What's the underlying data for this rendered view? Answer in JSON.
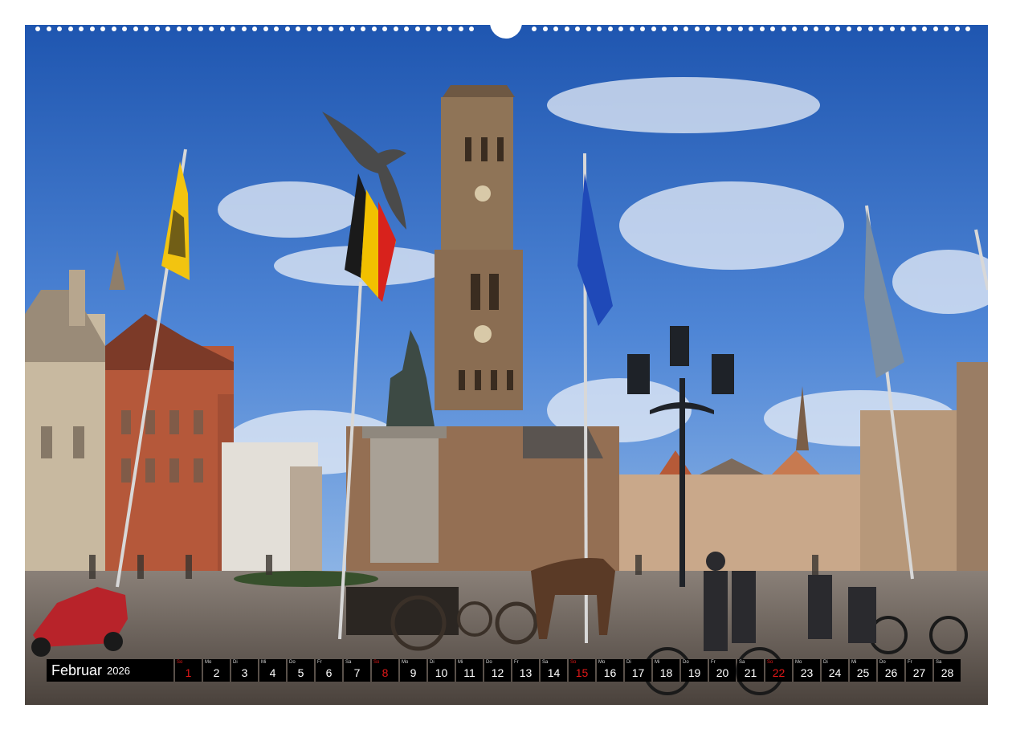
{
  "calendar": {
    "month": "Februar",
    "year": "2026",
    "days": [
      {
        "wd": "So",
        "num": "1",
        "sunday": true
      },
      {
        "wd": "Mo",
        "num": "2",
        "sunday": false
      },
      {
        "wd": "Di",
        "num": "3",
        "sunday": false
      },
      {
        "wd": "Mi",
        "num": "4",
        "sunday": false
      },
      {
        "wd": "Do",
        "num": "5",
        "sunday": false
      },
      {
        "wd": "Fr",
        "num": "6",
        "sunday": false
      },
      {
        "wd": "Sa",
        "num": "7",
        "sunday": false
      },
      {
        "wd": "So",
        "num": "8",
        "sunday": true
      },
      {
        "wd": "Mo",
        "num": "9",
        "sunday": false
      },
      {
        "wd": "Di",
        "num": "10",
        "sunday": false
      },
      {
        "wd": "Mi",
        "num": "11",
        "sunday": false
      },
      {
        "wd": "Do",
        "num": "12",
        "sunday": false
      },
      {
        "wd": "Fr",
        "num": "13",
        "sunday": false
      },
      {
        "wd": "Sa",
        "num": "14",
        "sunday": false
      },
      {
        "wd": "So",
        "num": "15",
        "sunday": true
      },
      {
        "wd": "Mo",
        "num": "16",
        "sunday": false
      },
      {
        "wd": "Di",
        "num": "17",
        "sunday": false
      },
      {
        "wd": "Mi",
        "num": "18",
        "sunday": false
      },
      {
        "wd": "Do",
        "num": "19",
        "sunday": false
      },
      {
        "wd": "Fr",
        "num": "20",
        "sunday": false
      },
      {
        "wd": "Sa",
        "num": "21",
        "sunday": false
      },
      {
        "wd": "So",
        "num": "22",
        "sunday": true
      },
      {
        "wd": "Mo",
        "num": "23",
        "sunday": false
      },
      {
        "wd": "Di",
        "num": "24",
        "sunday": false
      },
      {
        "wd": "Mi",
        "num": "25",
        "sunday": false
      },
      {
        "wd": "Do",
        "num": "26",
        "sunday": false
      },
      {
        "wd": "Fr",
        "num": "27",
        "sunday": false
      },
      {
        "wd": "Sa",
        "num": "28",
        "sunday": false
      }
    ]
  },
  "colors": {
    "sunday": "#e01818",
    "bar": "#000000",
    "sky": "#2f67c2"
  }
}
